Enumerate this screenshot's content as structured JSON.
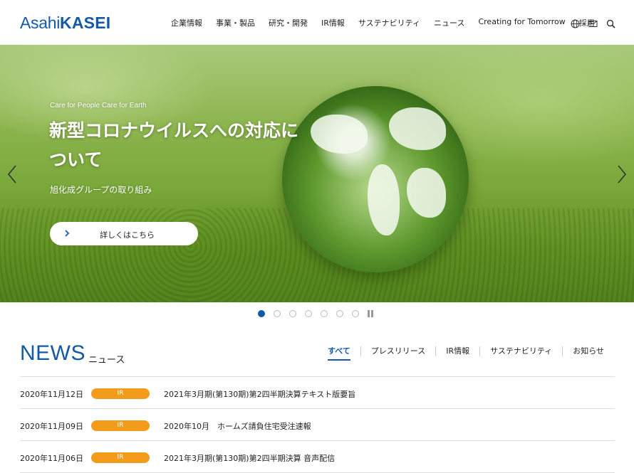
{
  "logo": {
    "part1": "Asahi",
    "part2": "KASEI"
  },
  "nav": {
    "items": [
      {
        "label": "企業情報"
      },
      {
        "label": "事業・製品"
      },
      {
        "label": "研究・開発"
      },
      {
        "label": "IR情報"
      },
      {
        "label": "サステナビリティ"
      },
      {
        "label": "ニュース"
      },
      {
        "label": "Creating for Tomorrow"
      },
      {
        "label": "採用"
      }
    ]
  },
  "utility": {
    "icons": [
      "globe-icon",
      "mail-icon",
      "search-icon"
    ]
  },
  "hero": {
    "eyebrow": "Care for People Care for Earth",
    "headline": "新型コロナウイルスへの対応について",
    "subline": "旭化成グループの取り組み",
    "cta_label": "詳しくはこちら"
  },
  "carousel": {
    "slides": 7,
    "active_index": 0
  },
  "news": {
    "title": "NEWS",
    "subtitle": "ニュース",
    "filters": [
      {
        "label": "すべて",
        "active": true
      },
      {
        "label": "プレスリリース",
        "active": false
      },
      {
        "label": "IR情報",
        "active": false
      },
      {
        "label": "サステナビリティ",
        "active": false
      },
      {
        "label": "お知らせ",
        "active": false
      }
    ],
    "items": [
      {
        "date": "2020年11月12日",
        "category": "IR",
        "title": "2021年3月期(第130期)第2四半期決算テキスト版要旨"
      },
      {
        "date": "2020年11月09日",
        "category": "IR",
        "title": "2020年10月　ホームズ請負住宅受注速報"
      },
      {
        "date": "2020年11月06日",
        "category": "IR",
        "title": "2021年3月期(第130期)第2四半期決算 音声配信"
      }
    ]
  },
  "colors": {
    "brand": "#1459a8",
    "badge": "#f39b1b"
  }
}
